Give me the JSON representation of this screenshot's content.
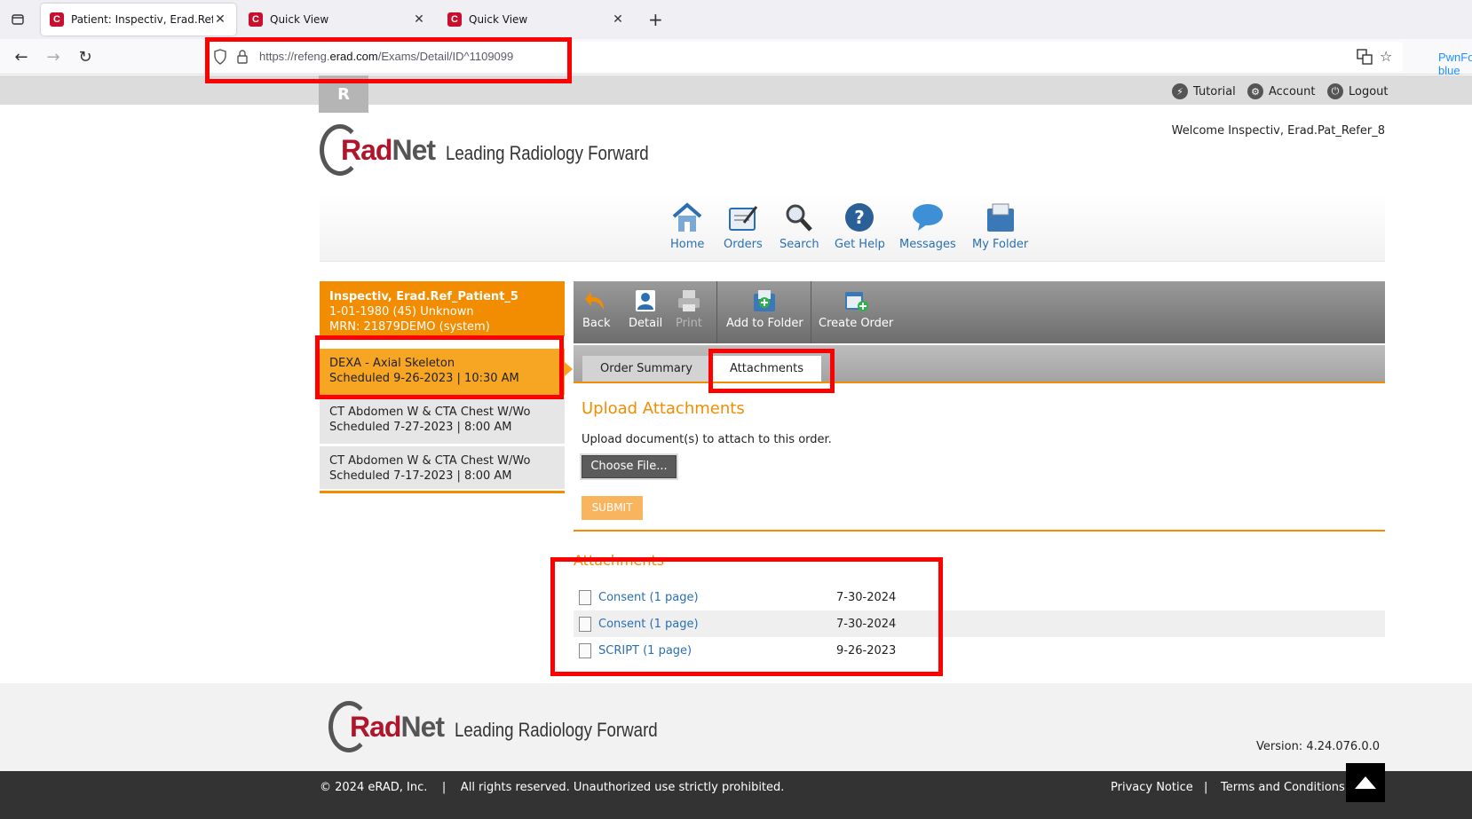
{
  "browser": {
    "tabs": [
      {
        "title": "Patient: Inspectiv, Erad.Ref_Pati",
        "active": true
      },
      {
        "title": "Quick View",
        "active": false
      },
      {
        "title": "Quick View",
        "active": false
      }
    ],
    "url_prefix": "https://refeng.",
    "url_domain": "erad.com",
    "url_path": "/Exams/Detail/ID^1109099",
    "container_label": "PwnFox-blue",
    "new_tab": "+"
  },
  "topbar": {
    "tutorial": "Tutorial",
    "account": "Account",
    "logout": "Logout"
  },
  "header": {
    "brand_rad": "Rad",
    "brand_net": "Net",
    "tagline": "Leading Radiology Forward",
    "welcome": "Welcome Inspectiv, Erad.Pat_Refer_8"
  },
  "mainnav": {
    "items": [
      "Home",
      "Orders",
      "Search",
      "Get Help",
      "Messages",
      "My Folder"
    ]
  },
  "patient": {
    "name": "Inspectiv, Erad.Ref_Patient_5",
    "dob": "1-01-1980 (45) Unknown",
    "mrn": "MRN: 21879DEMO (system)"
  },
  "exams": [
    {
      "name": "DEXA - Axial Skeleton",
      "scheduled": "Scheduled 9-26-2023 | 10:30 AM"
    },
    {
      "name": "CT Abdomen W & CTA Chest W/Wo",
      "scheduled": "Scheduled 7-27-2023 | 8:00 AM"
    },
    {
      "name": "CT Abdomen W & CTA Chest W/Wo",
      "scheduled": "Scheduled 7-17-2023 | 8:00 AM"
    }
  ],
  "toolbar": {
    "back": "Back",
    "detail": "Detail",
    "print": "Print",
    "add_to_folder": "Add to Folder",
    "create_order": "Create Order"
  },
  "tabs": {
    "order_summary": "Order Summary",
    "attachments": "Attachments"
  },
  "upload": {
    "title": "Upload Attachments",
    "description": "Upload document(s) to attach to this order.",
    "choose_file": "Choose File...",
    "submit": "SUBMIT"
  },
  "attachments": {
    "title": "Attachments",
    "items": [
      {
        "name": "Consent (1 page)",
        "date": "7-30-2024"
      },
      {
        "name": "Consent (1 page)",
        "date": "7-30-2024"
      },
      {
        "name": "SCRIPT (1 page)",
        "date": "9-26-2023"
      }
    ]
  },
  "footer": {
    "version": "Version: 4.24.076.0.0",
    "copyright": "© 2024 eRAD, Inc.    |    All rights reserved. Unauthorized use strictly prohibited.",
    "privacy": "Privacy Notice",
    "separator": "|",
    "terms": "Terms and Conditions"
  },
  "colors": {
    "accent_orange": "#f28c00",
    "selected_exam": "#f6a623",
    "link_blue": "#2a6fb3",
    "brand_red": "#b0162b",
    "annotation_red": "#ff0000"
  }
}
